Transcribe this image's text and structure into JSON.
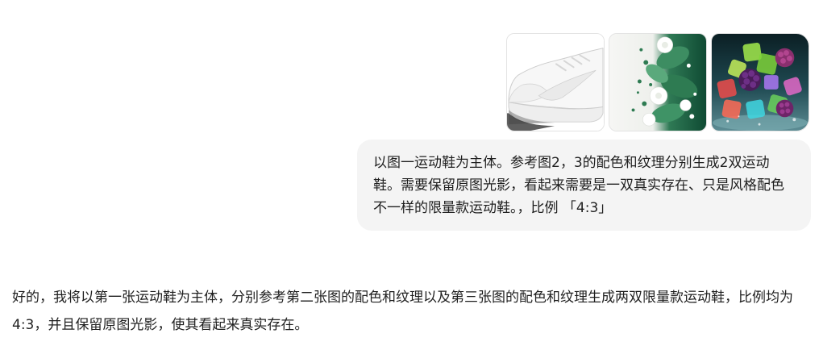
{
  "conversation": {
    "user_message": {
      "images": [
        {
          "subject": "white low-top sneaker"
        },
        {
          "subject": "green and white floral texture"
        },
        {
          "subject": "colorful jelly cubes with berries"
        }
      ],
      "text": "以图一运动鞋为主体。参考图2，3的配色和纹理分别生成2双运动鞋。需要保留原图光影，看起来需要是一双真实存在、只是风格配色不一样的限量款运动鞋。，比例 「4:3」"
    },
    "assistant_message": {
      "text": "好的，我将以第一张运动鞋为主体，分别参考第二张图的配色和纹理以及第三张图的配色和纹理生成两双限量款运动鞋，比例均为 4:3，并且保留原图光影，使其看起来真实存在。"
    }
  }
}
